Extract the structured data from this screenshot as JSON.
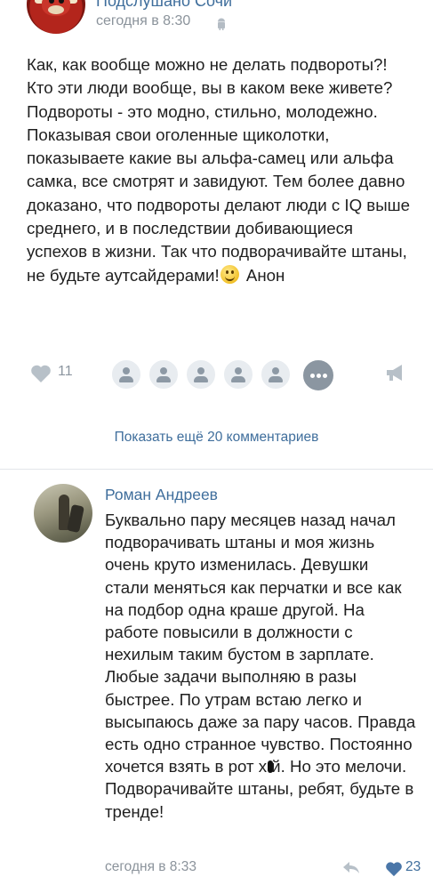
{
  "post": {
    "group_name": "Подслушано Сочи",
    "time": "сегодня в 8:30",
    "platform_icon": "android-icon",
    "text": "Как, как вообще можно не делать подвороты?! Кто эти люди вообще, вы в каком веке живете? Подвороты - это модно, стильно, молодежно. Показывая свои оголенные щиколотки, показываете какие вы альфа-самец или альфа самка, все смотрят и завидуют. Тем более давно доказано, что подвороты делают люди с IQ выше среднего, и в последствии добивающиеся успехов в жизни. Так что подворачивайте штаны, не будьте аутсайдерами!",
    "signature": "Анон",
    "likes": "11",
    "liker_count_shown": 5
  },
  "show_more_comments": "Показать ещё 20 комментариев",
  "comment": {
    "author": "Роман Андреев",
    "text_before_censor": "Буквально пару месяцев назад начал подворачивать штаны и моя жизнь очень круто изменилась. Девушки стали меняться как перчатки и все как на подбор одна краше другой. На работе повысили в должности с нехилым таким бустом в зарплате. Любые задачи выполняю в разы быстрее. По утрам встаю легко и высыпаюсь даже за пару часов. Правда есть одно странное чувство. Постоянно хочется взять в рот х",
    "text_after_censor": "й. Но это мелочи. Подворачивайте штаны, ребят, будьте в тренде!",
    "time": "сегодня в 8:33",
    "likes": "23"
  },
  "colors": {
    "link": "#3f6e9c",
    "meta": "#8b939b",
    "liked_heart": "#4a76a8",
    "heart": "#b7c0c8"
  }
}
